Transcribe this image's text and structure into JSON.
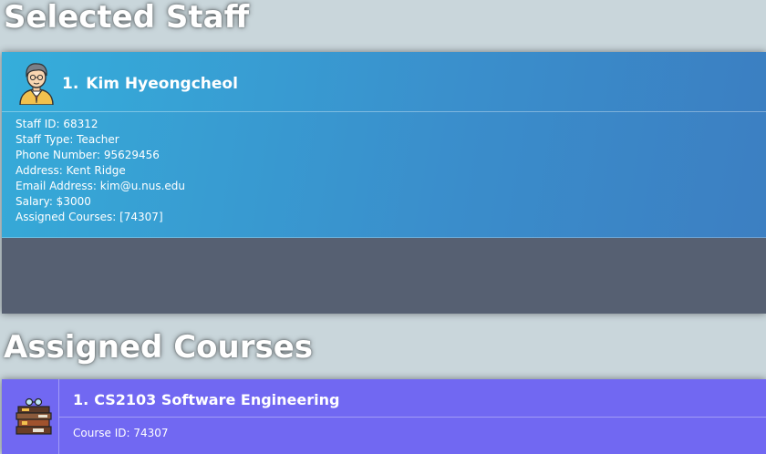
{
  "selected_staff": {
    "section_title": "Selected Staff",
    "index": "1.",
    "name": "Kim Hyeongcheol",
    "avatar_icon": "teacher-avatar-icon",
    "details": [
      "Staff ID: 68312",
      "Staff Type: Teacher",
      "Phone Number: 95629456",
      "Address: Kent Ridge",
      "Email Address: kim@u.nus.edu",
      "Salary: $3000",
      "Assigned Courses: [74307]"
    ]
  },
  "assigned_courses": {
    "section_title": "Assigned Courses",
    "courses": [
      {
        "index": "1.",
        "title": "CS2103 Software Engineering",
        "course_id": "Course ID: 74307",
        "icon": "books-icon"
      }
    ]
  },
  "colors": {
    "background": "#c9d6db",
    "staff_card": "#3a8fcc",
    "staff_card_footer": "#566072",
    "course_card": "#7168f2"
  }
}
